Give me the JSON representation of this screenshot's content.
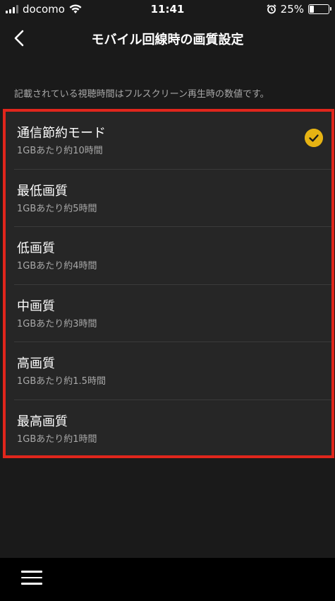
{
  "status": {
    "carrier": "docomo",
    "time": "11:41",
    "battery": "25%",
    "battery_level": 0.25
  },
  "header": {
    "title": "モバイル回線時の画質設定"
  },
  "note": "記載されている視聴時間はフルスクリーン再生時の数値です。",
  "options": [
    {
      "label": "通信節約モード",
      "sub": "1GBあたり約10時間",
      "selected": true
    },
    {
      "label": "最低画質",
      "sub": "1GBあたり約5時間",
      "selected": false
    },
    {
      "label": "低画質",
      "sub": "1GBあたり約4時間",
      "selected": false
    },
    {
      "label": "中画質",
      "sub": "1GBあたり約3時間",
      "selected": false
    },
    {
      "label": "高画質",
      "sub": "1GBあたり約1.5時間",
      "selected": false
    },
    {
      "label": "最高画質",
      "sub": "1GBあたり約1時間",
      "selected": false
    }
  ],
  "colors": {
    "accent": "#e6b313",
    "highlight_border": "#e0261c",
    "background": "#1a1a1a"
  },
  "icons": {
    "back": "chevron-left-icon",
    "selected": "check-circle-icon",
    "menu": "hamburger-menu-icon"
  }
}
